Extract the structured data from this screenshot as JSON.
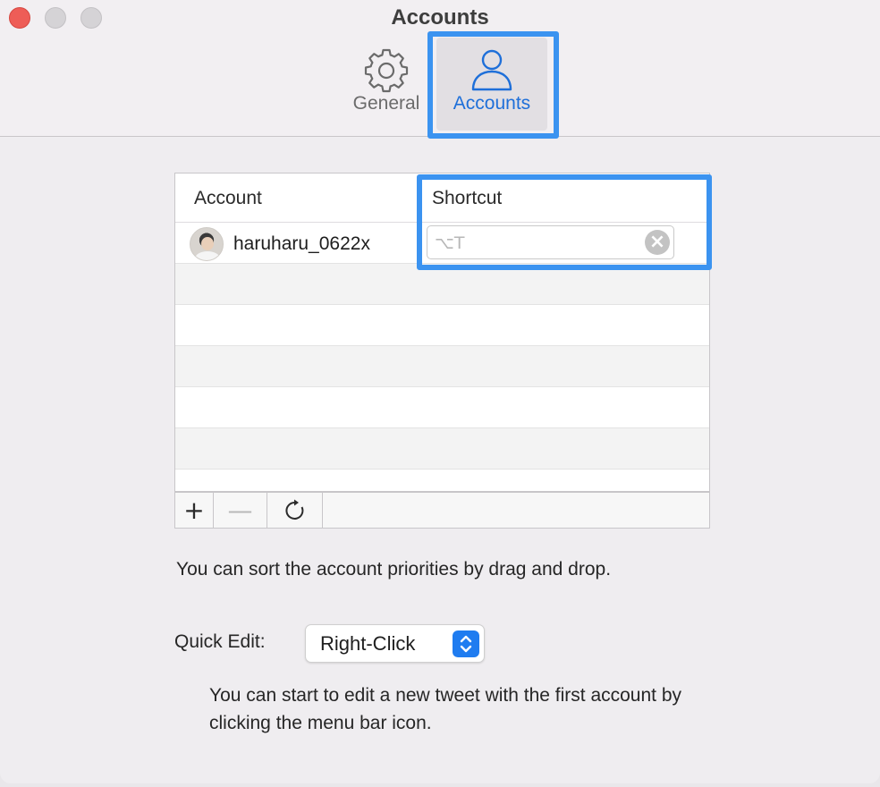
{
  "window": {
    "title": "Accounts"
  },
  "toolbar": {
    "items": [
      {
        "label": "General",
        "icon": "gear-icon",
        "selected": false
      },
      {
        "label": "Accounts",
        "icon": "person-icon",
        "selected": true
      }
    ]
  },
  "table": {
    "columns": [
      "Account",
      "Shortcut"
    ],
    "rows": [
      {
        "account": "haruharu_0622x",
        "shortcut_placeholder": "⌥T"
      }
    ],
    "buttons": {
      "add": "+",
      "remove": "—",
      "refresh": "↻"
    }
  },
  "hint": "You can sort the account priorities by drag and drop.",
  "quick_edit": {
    "label": "Quick Edit:",
    "value": "Right-Click"
  },
  "description": "You can start to edit a new tweet with the first account by clicking the menu bar icon.",
  "colors": {
    "accent": "#1e6fd9",
    "highlight": "#3b93f0"
  }
}
